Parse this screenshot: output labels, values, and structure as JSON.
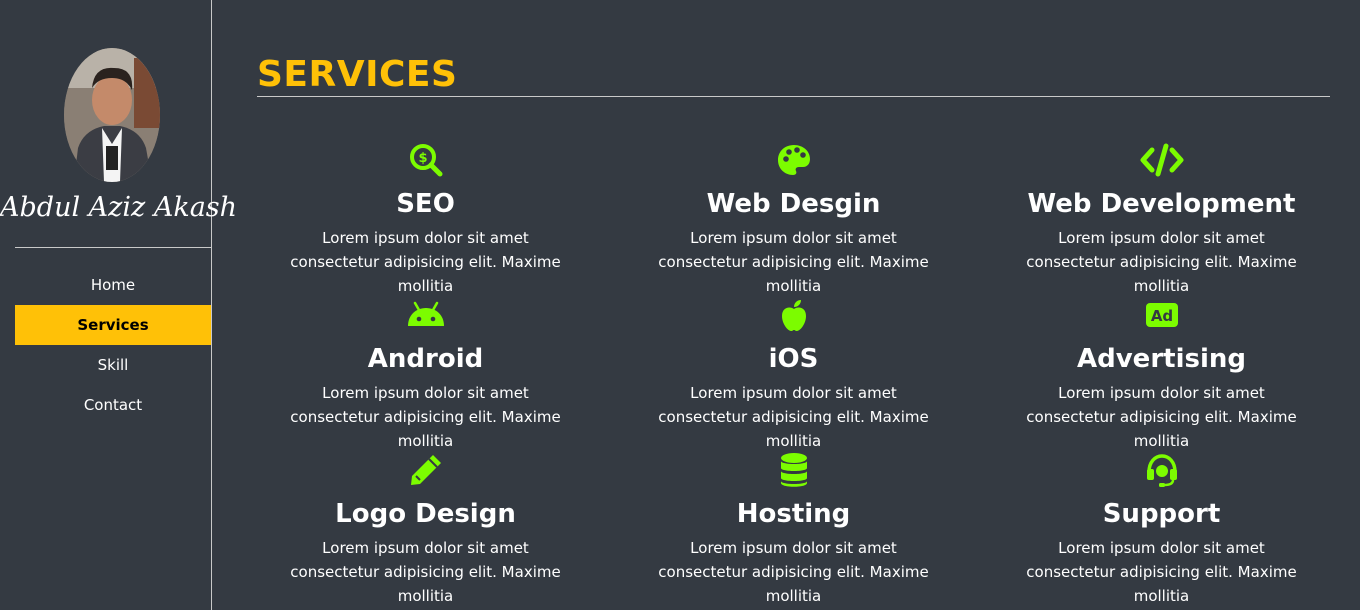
{
  "sidebar": {
    "brand": "Abdul Aziz Akash",
    "nav": [
      {
        "label": "Home",
        "active": false
      },
      {
        "label": "Services",
        "active": true
      },
      {
        "label": "Skill",
        "active": false
      },
      {
        "label": "Contact",
        "active": false
      }
    ]
  },
  "main": {
    "title": "SERVICES",
    "services": [
      {
        "icon": "seo-search-dollar-icon",
        "title": "SEO",
        "desc": "Lorem ipsum dolor sit amet consectetur adipisicing elit. Maxime mollitia"
      },
      {
        "icon": "palette-icon",
        "title": "Web Desgin",
        "desc": "Lorem ipsum dolor sit amet consectetur adipisicing elit. Maxime mollitia"
      },
      {
        "icon": "code-icon",
        "title": "Web Development",
        "desc": "Lorem ipsum dolor sit amet consectetur adipisicing elit. Maxime mollitia"
      },
      {
        "icon": "android-icon",
        "title": "Android",
        "desc": "Lorem ipsum dolor sit amet consectetur adipisicing elit. Maxime mollitia"
      },
      {
        "icon": "apple-icon",
        "title": "iOS",
        "desc": "Lorem ipsum dolor sit amet consectetur adipisicing elit. Maxime mollitia"
      },
      {
        "icon": "ad-icon",
        "title": "Advertising",
        "desc": "Lorem ipsum dolor sit amet consectetur adipisicing elit. Maxime mollitia"
      },
      {
        "icon": "pencil-icon",
        "title": "Logo Design",
        "desc": "Lorem ipsum dolor sit amet consectetur adipisicing elit. Maxime mollitia"
      },
      {
        "icon": "database-icon",
        "title": "Hosting",
        "desc": "Lorem ipsum dolor sit amet consectetur adipisicing elit. Maxime mollitia"
      },
      {
        "icon": "headset-icon",
        "title": "Support",
        "desc": "Lorem ipsum dolor sit amet consectetur adipisicing elit. Maxime mollitia"
      }
    ],
    "ad_icon_text": "Ad"
  },
  "colors": {
    "background": "#343a42",
    "accent": "#ffc107",
    "icon": "#7cfc00",
    "text": "#ffffff"
  }
}
